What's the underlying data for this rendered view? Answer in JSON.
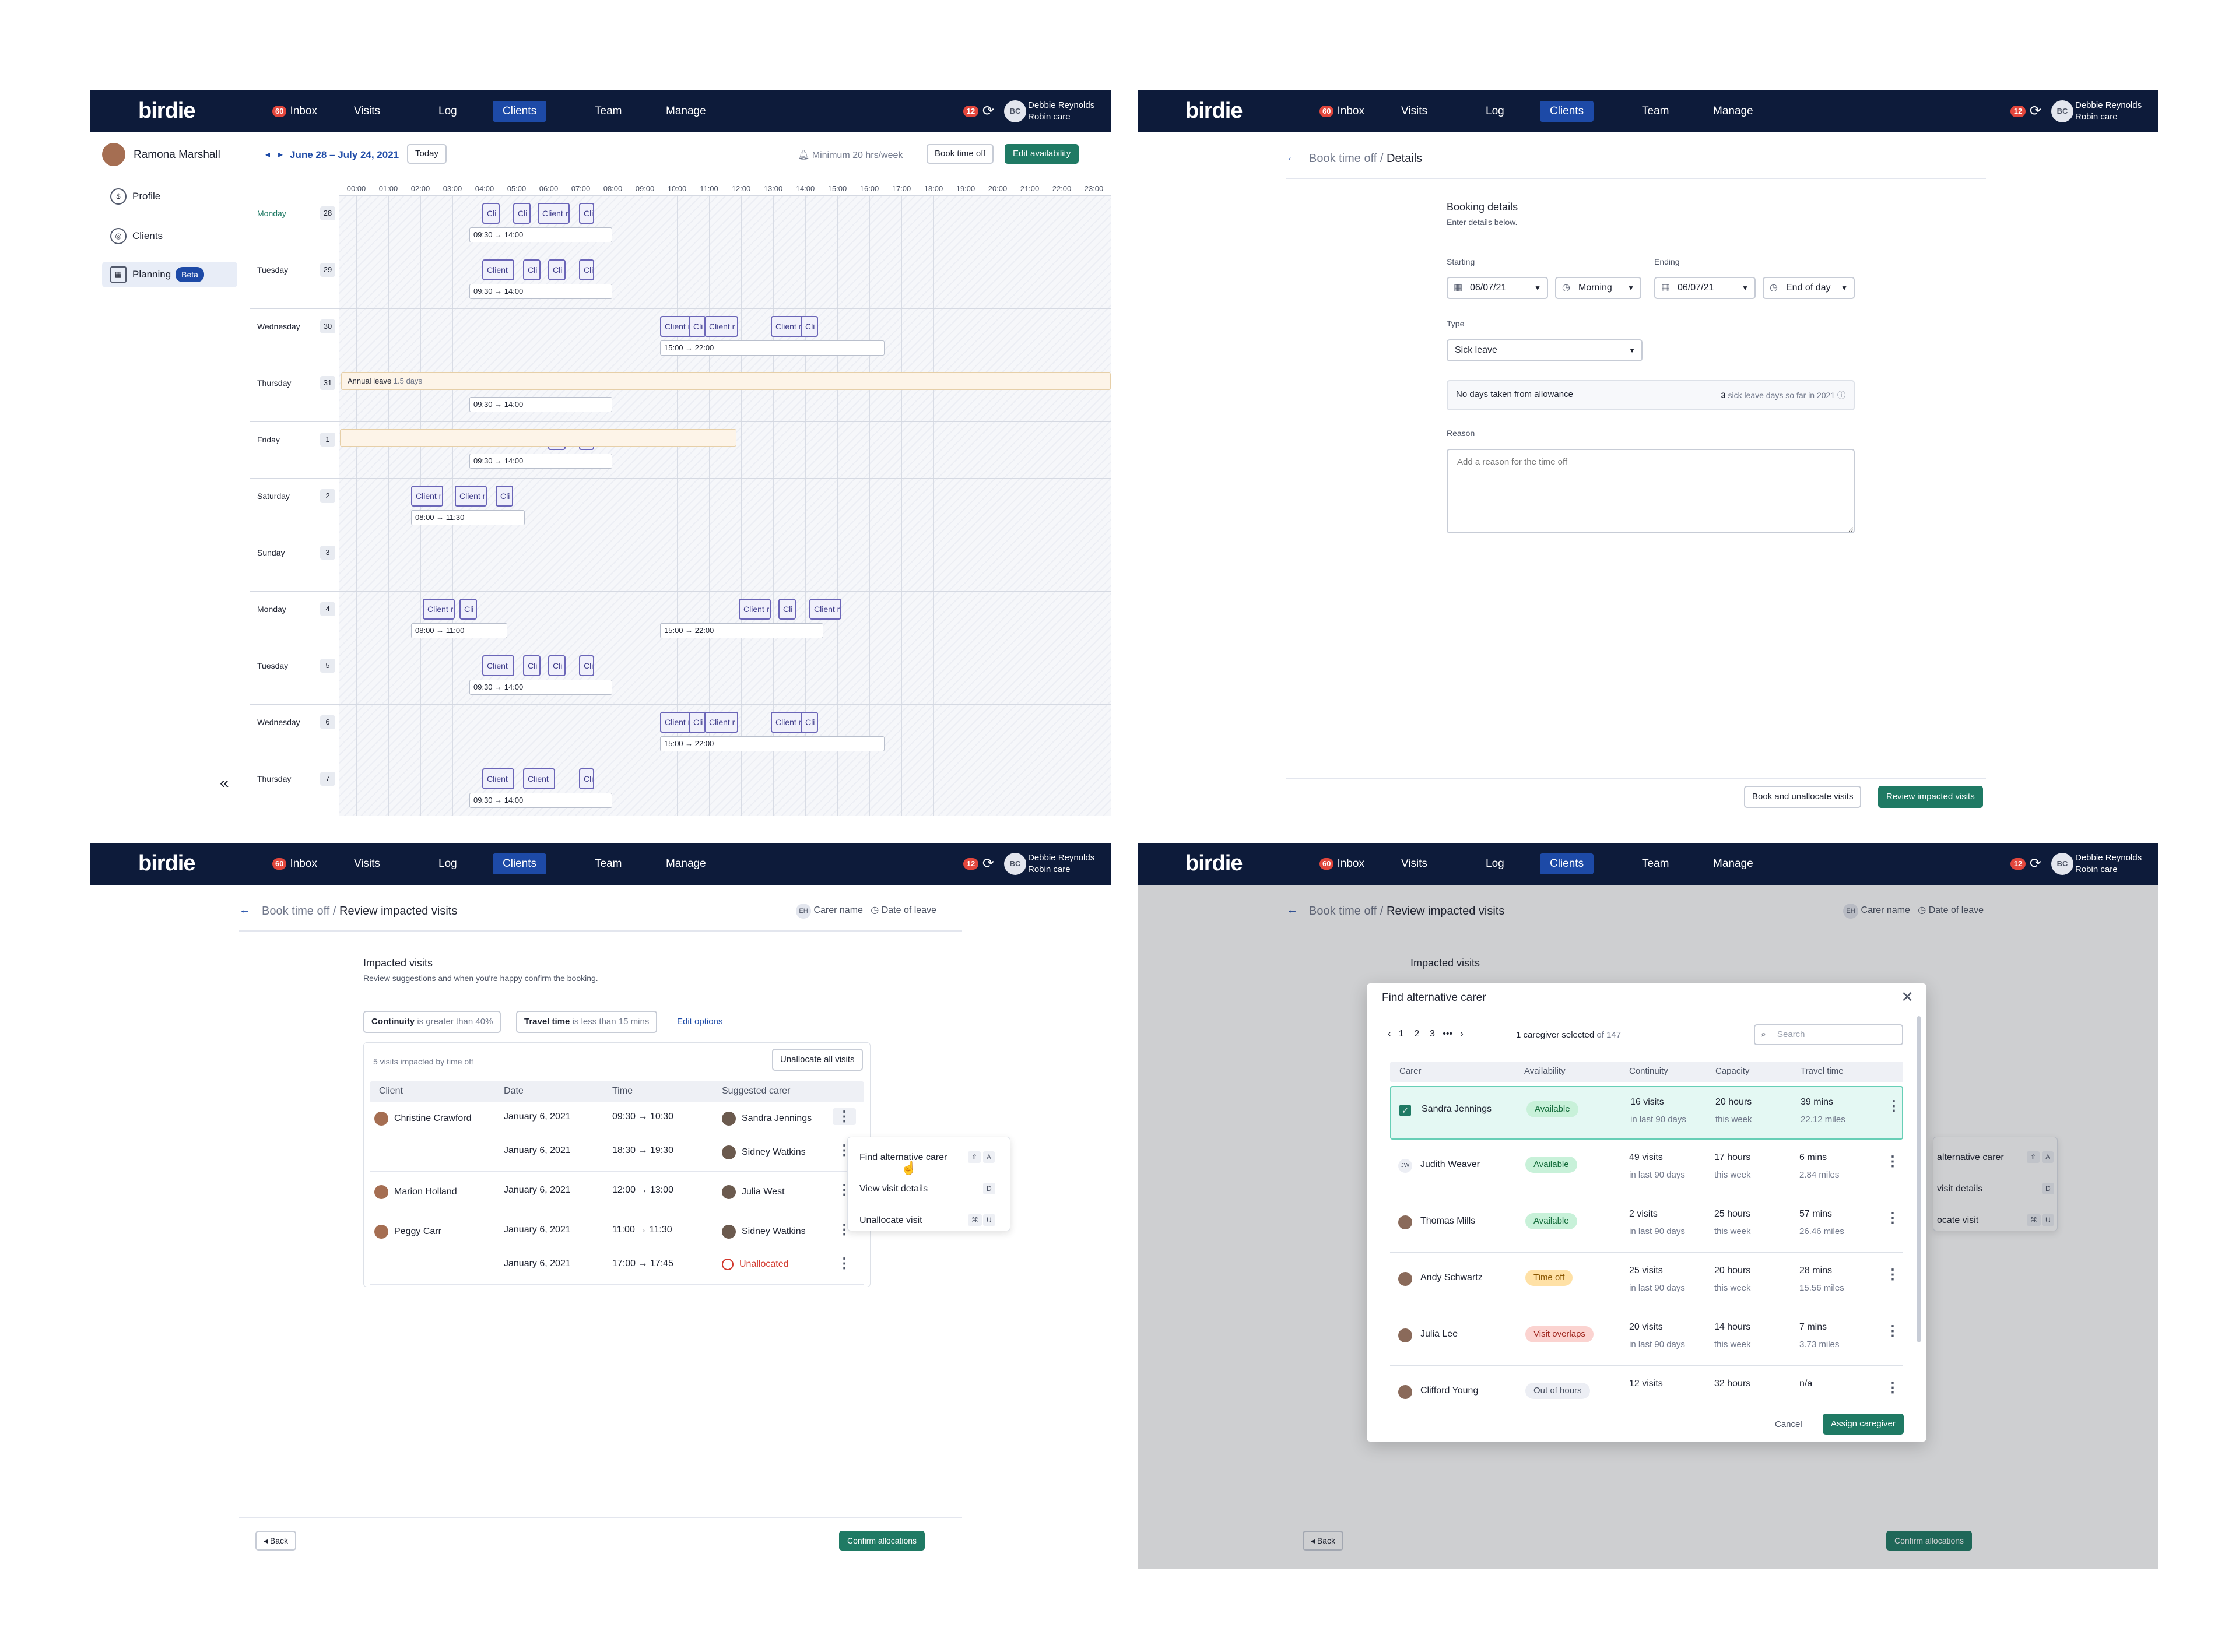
{
  "nav": {
    "logo": "birdie",
    "badge": "60",
    "items": [
      "Inbox",
      "Visits",
      "Log",
      "Clients",
      "Team",
      "Manage"
    ],
    "active": "Clients",
    "notif": "12",
    "avatar": "BC",
    "user": "Debbie Reynolds",
    "org": "Robin care"
  },
  "planning": {
    "client": "Ramona Marshall",
    "sidebar": [
      {
        "label": "Profile",
        "icon": "profile-icon"
      },
      {
        "label": "Clients",
        "icon": "clients-icon"
      },
      {
        "label": "Planning",
        "icon": "calendar-icon",
        "badge": "Beta"
      }
    ],
    "range": "June 28 – July 24, 2021",
    "today": "Today",
    "minimum": "Minimum 20 hrs/week",
    "book": "Book time off",
    "edit": "Edit availability",
    "hours": [
      "00:00",
      "01:00",
      "02:00",
      "03:00",
      "04:00",
      "05:00",
      "06:00",
      "07:00",
      "08:00",
      "09:00",
      "10:00",
      "11:00",
      "12:00",
      "13:00",
      "14:00",
      "15:00",
      "16:00",
      "17:00",
      "18:00",
      "19:00",
      "20:00",
      "21:00",
      "22:00",
      "23:00"
    ],
    "days": [
      {
        "name": "Monday",
        "num": "28",
        "times": [
          "09:30 → 14:00"
        ],
        "visits": [
          "Cli",
          "Cli",
          "Client r",
          "Cli"
        ]
      },
      {
        "name": "Tuesday",
        "num": "29",
        "times": [
          "09:30 → 14:00"
        ],
        "visits": [
          "Client",
          "Cli",
          "Cli",
          "Cli"
        ]
      },
      {
        "name": "Wednesday",
        "num": "30",
        "times": [
          "15:00 → 22:00"
        ],
        "visits": [
          "Client r",
          "Cli",
          "Client r",
          "Client r",
          "Cli"
        ]
      },
      {
        "name": "Thursday",
        "num": "31",
        "times": [
          "09:30 → 14:00"
        ],
        "visits": [],
        "leave": "Annual leave",
        "leave_dur": "1.5 days"
      },
      {
        "name": "Friday",
        "num": "1",
        "times": [
          "09:30 → 14:00"
        ],
        "visits": [
          "Cli",
          "Cli"
        ]
      },
      {
        "name": "Saturday",
        "num": "2",
        "times": [
          "08:00 → 11:30"
        ],
        "visits": [
          "Client r",
          "Client r",
          "Cli"
        ]
      },
      {
        "name": "Sunday",
        "num": "3",
        "times": [],
        "visits": []
      },
      {
        "name": "Monday",
        "num": "4",
        "times": [
          "08:00 → 11:00",
          "15:00 → 22:00"
        ],
        "visits": [
          "Client r",
          "Cli",
          "Client r",
          "Cli",
          "Client r"
        ]
      },
      {
        "name": "Tuesday",
        "num": "5",
        "times": [
          "09:30 → 14:00"
        ],
        "visits": [
          "Client",
          "Cli",
          "Cli",
          "Cli"
        ]
      },
      {
        "name": "Wednesday",
        "num": "6",
        "times": [
          "15:00 → 22:00"
        ],
        "visits": [
          "Client r",
          "Cli",
          "Client r",
          "Client r",
          "Cli"
        ]
      },
      {
        "name": "Thursday",
        "num": "7",
        "times": [
          "09:30 → 14:00"
        ],
        "visits": [
          "Client",
          "Client",
          "Cli"
        ]
      }
    ]
  },
  "details": {
    "crumb": "Book time off",
    "crumb_current": "Details",
    "heading": "Booking details",
    "sub": "Enter details below.",
    "starting": "Starting",
    "start_date": "06/07/21",
    "start_part": "Morning",
    "ending": "Ending",
    "end_date": "06/07/21",
    "end_part": "End of day",
    "type_label": "Type",
    "type": "Sick leave",
    "allowance": "No days taken from allowance",
    "sick_count": "3",
    "sick_text": "sick leave days so far in 2021",
    "reason_label": "Reason",
    "reason_placeholder": "Add a reason for the time off",
    "book_unalloc": "Book and unallocate visits",
    "review": "Review impacted visits"
  },
  "review": {
    "crumb": "Book time off",
    "crumb_current": "Review impacted visits",
    "carer_init": "EH",
    "carer_name": "Carer name",
    "date_leave": "Date of leave",
    "heading": "Impacted visits",
    "sub": "Review suggestions and when you're happy confirm the booking.",
    "f1_key": "Continuity",
    "f1_rest": "is greater than 40%",
    "f2_key": "Travel time",
    "f2_rest": "is less than 15 mins",
    "edit": "Edit options",
    "count": "5 visits impacted by time off",
    "unalloc_all": "Unallocate all visits",
    "headers": [
      "Client",
      "Date",
      "Time",
      "Suggested carer"
    ],
    "rows": [
      {
        "client": "Christine Crawford",
        "date": "January 6, 2021",
        "time": "09:30 → 10:30",
        "carer": "Sandra Jennings"
      },
      {
        "client": "",
        "date": "January 6, 2021",
        "time": "18:30 → 19:30",
        "carer": "Sidney Watkins"
      },
      {
        "client": "Marion Holland",
        "date": "January 6, 2021",
        "time": "12:00 → 13:00",
        "carer": "Julia West"
      },
      {
        "client": "Peggy Carr",
        "date": "January 6, 2021",
        "time": "11:00 → 11:30",
        "carer": "Sidney Watkins"
      },
      {
        "client": "",
        "date": "January 6, 2021",
        "time": "17:00 → 17:45",
        "carer": "Unallocated"
      }
    ],
    "menu": [
      {
        "label": "Find alternative carer",
        "keys": [
          "⇧",
          "A"
        ]
      },
      {
        "label": "View visit details",
        "keys": [
          "D"
        ]
      },
      {
        "label": "Unallocate visit",
        "keys": [
          "⌘",
          "U"
        ]
      }
    ],
    "back": "Back",
    "confirm": "Confirm allocations"
  },
  "modal": {
    "title": "Find alternative carer",
    "pages": [
      "1",
      "2",
      "3",
      "•••"
    ],
    "selected": "1 caregiver selected",
    "of": "of 147",
    "search": "Search",
    "headers": [
      "Carer",
      "Availability",
      "Continuity",
      "Capacity",
      "Travel time"
    ],
    "rows": [
      {
        "name": "Sandra Jennings",
        "status": "Available",
        "cont": "16 visits",
        "cont2": "in last 90 days",
        "cap": "20 hours",
        "cap2": "this week",
        "travel": "39 mins",
        "travel2": "22.12 miles"
      },
      {
        "name": "Judith Weaver",
        "init": "JW",
        "status": "Available",
        "cont": "49 visits",
        "cont2": "in last 90 days",
        "cap": "17 hours",
        "cap2": "this week",
        "travel": "6 mins",
        "travel2": "2.84 miles"
      },
      {
        "name": "Thomas Mills",
        "status": "Available",
        "cont": "2 visits",
        "cont2": "in last 90 days",
        "cap": "25 hours",
        "cap2": "this week",
        "travel": "57 mins",
        "travel2": "26.46 miles"
      },
      {
        "name": "Andy Schwartz",
        "status": "Time off",
        "cont": "25 visits",
        "cont2": "in last 90 days",
        "cap": "20 hours",
        "cap2": "this week",
        "travel": "28 mins",
        "travel2": "15.56 miles"
      },
      {
        "name": "Julia Lee",
        "status": "Visit overlaps",
        "cont": "20 visits",
        "cont2": "in last 90 days",
        "cap": "14 hours",
        "cap2": "this week",
        "travel": "7 mins",
        "travel2": "3.73 miles"
      },
      {
        "name": "Clifford Young",
        "status": "Out of hours",
        "cont": "12 visits",
        "cont2": "",
        "cap": "32 hours",
        "cap2": "",
        "travel": "n/a",
        "travel2": ""
      }
    ],
    "cancel": "Cancel",
    "assign": "Assign caregiver",
    "bg_menu": [
      "alternative carer",
      "visit details",
      "ocate visit"
    ],
    "bg_heading": "Impacted visits"
  }
}
